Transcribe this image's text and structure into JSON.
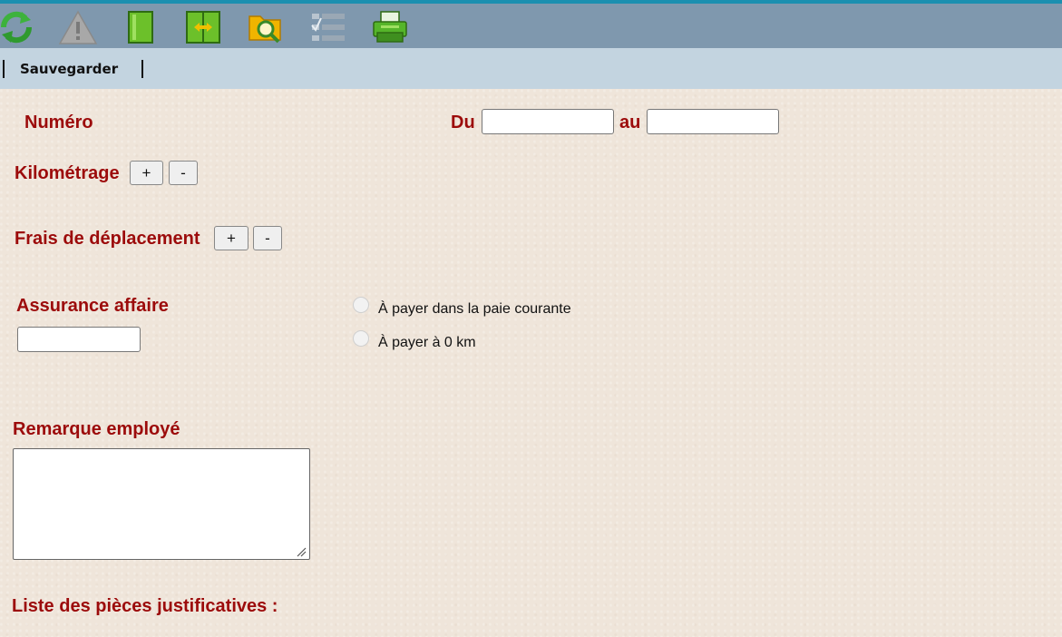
{
  "toolbar": {
    "icons": [
      {
        "name": "refresh-icon",
        "color": "#3db23d"
      },
      {
        "name": "warning-icon",
        "color": "#a8a8a8"
      },
      {
        "name": "single-panel-icon",
        "color": "#6cc02a"
      },
      {
        "name": "split-panel-icon",
        "color": "#6cc02a"
      },
      {
        "name": "folder-search-icon",
        "color": "#f0b400"
      },
      {
        "name": "checklist-icon",
        "color": "#9aa8b5"
      },
      {
        "name": "printer-icon",
        "color": "#55b52a"
      }
    ]
  },
  "actions": {
    "save_label": "Sauvegarder"
  },
  "form": {
    "numero_label": "Numéro",
    "du_label": "Du",
    "du_value": "",
    "au_label": "au",
    "au_value": "",
    "kilometrage_label": "Kilométrage",
    "frais_label": "Frais de déplacement",
    "plus_label": "+",
    "minus_label": "-",
    "assurance_label": "Assurance affaire",
    "assurance_value": "",
    "radio_options": [
      {
        "label": "À payer dans la paie courante",
        "checked": false
      },
      {
        "label": "À payer à 0 km",
        "checked": false
      }
    ],
    "remarque_label": "Remarque employé",
    "remarque_value": "",
    "pieces_label": "Liste des pièces justificatives :"
  },
  "colors": {
    "label_red": "#9c0b0b",
    "toolbar_bg": "#7f98ae",
    "subbar_bg": "#c3d4e0",
    "accent_top": "#1b8fb0",
    "page_bg": "#efe5da"
  }
}
